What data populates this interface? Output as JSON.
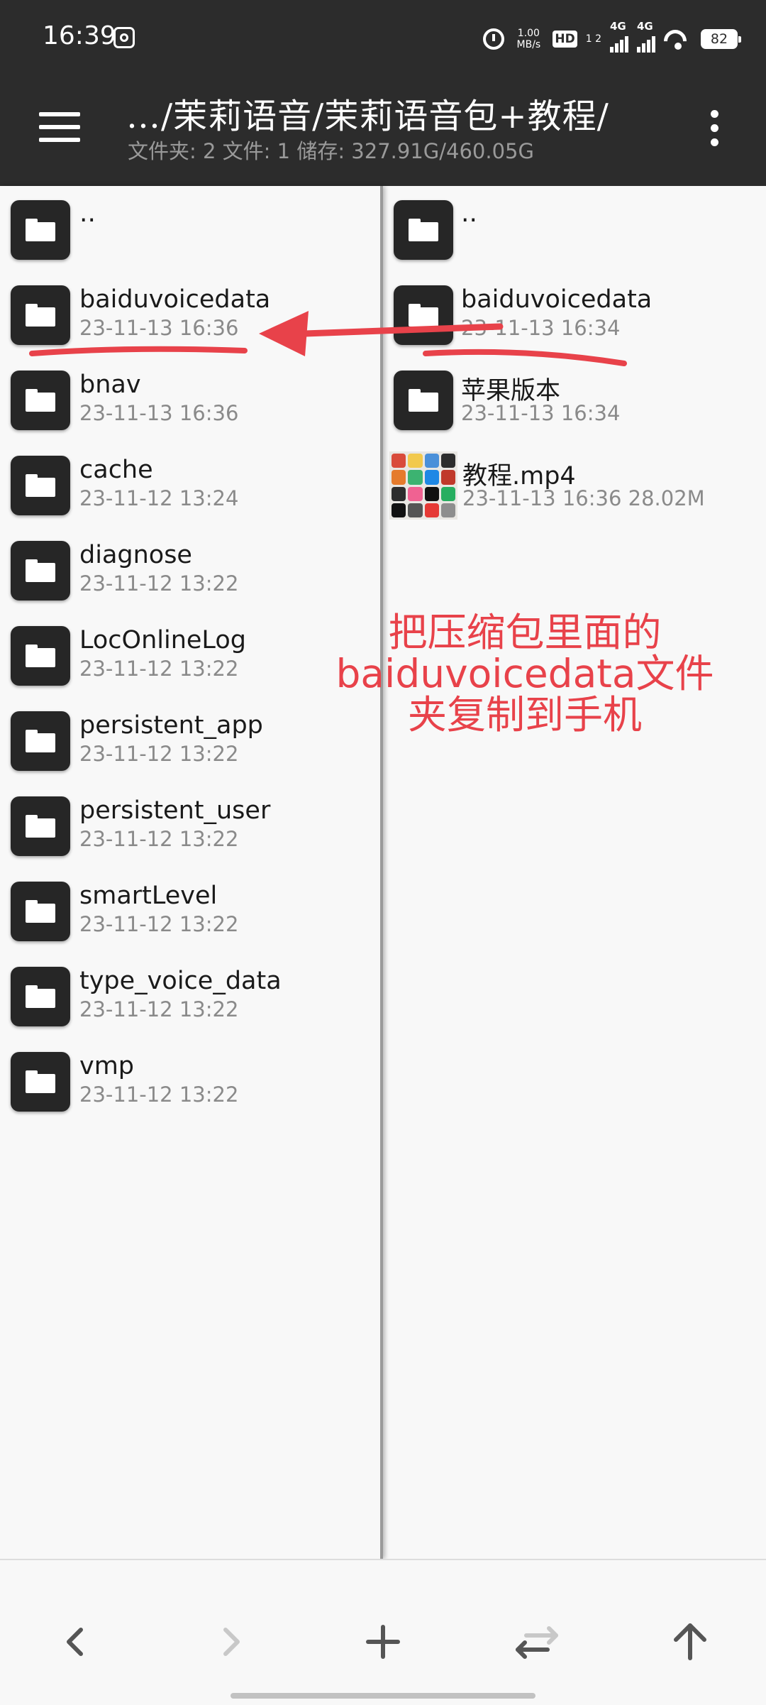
{
  "status_bar": {
    "time": "16:39",
    "net_speed_value": "1.00",
    "net_speed_unit": "MB/s",
    "hd_label": "HD",
    "hd_sub": "1 2",
    "signal1_label": "4G",
    "signal2_label": "4G",
    "battery": "82",
    "icons": [
      "notification-icon",
      "alarm-icon",
      "signal-icon",
      "wifi-icon",
      "battery-icon"
    ]
  },
  "header": {
    "path_title": "…/茉莉语音/茉莉语音包+教程/",
    "info": "文件夹: 2  文件: 1  储存: 327.91G/460.05G"
  },
  "left_pane": {
    "items": [
      {
        "name": "..",
        "date": ""
      },
      {
        "name": "baiduvoicedata",
        "date": "23-11-13 16:36"
      },
      {
        "name": "bnav",
        "date": "23-11-13 16:36"
      },
      {
        "name": "cache",
        "date": "23-11-12 13:24"
      },
      {
        "name": "diagnose",
        "date": "23-11-12 13:22"
      },
      {
        "name": "LocOnlineLog",
        "date": "23-11-12 13:22"
      },
      {
        "name": "persistent_app",
        "date": "23-11-12 13:22"
      },
      {
        "name": "persistent_user",
        "date": "23-11-12 13:22"
      },
      {
        "name": "smartLevel",
        "date": "23-11-12 13:22"
      },
      {
        "name": "type_voice_data",
        "date": "23-11-12 13:22"
      },
      {
        "name": "vmp",
        "date": "23-11-12 13:22"
      }
    ]
  },
  "right_pane": {
    "items": [
      {
        "name": "..",
        "date": ""
      },
      {
        "name": "baiduvoicedata",
        "date": "23-11-13 16:34"
      },
      {
        "name": "苹果版本",
        "date": "23-11-13 16:34"
      },
      {
        "name": "教程.mp4",
        "date": "23-11-13 16:36  28.02M"
      }
    ]
  },
  "annotation": {
    "line1": "把压缩包里面的",
    "line2": "baiduvoicedata文件",
    "line3": "夹复制到手机",
    "color": "#e8424a"
  },
  "bottom_bar": {
    "buttons": [
      "back-icon",
      "forward-icon",
      "add-icon",
      "swap-icon",
      "up-icon"
    ]
  },
  "colors": {
    "header_bg": "#2c2c2c",
    "pane_bg": "#f8f8f8",
    "folder_bg": "#262626"
  }
}
